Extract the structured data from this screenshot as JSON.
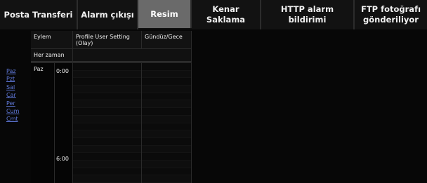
{
  "tabs": [
    {
      "label": "Posta Transferi"
    },
    {
      "label": "Alarm çıkışı"
    },
    {
      "label": "Resim"
    },
    {
      "label": "Kenar Saklama"
    },
    {
      "label": "HTTP alarm bildirimi"
    },
    {
      "label": "FTP fotoğrafı gönderiliyor"
    }
  ],
  "active_tab": "Resim",
  "days": [
    "Paz",
    "Pzt",
    "Sal",
    "Çar",
    "Per",
    "Cum",
    "Cmt"
  ],
  "table": {
    "col_action": "Eylem",
    "col_profile": "Profile User Setting (Olay)",
    "col_daynight": "Gündüz/Gece",
    "always_row": "Her zaman",
    "current_day": "Paz",
    "times": [
      "0:00",
      "6:00"
    ]
  }
}
